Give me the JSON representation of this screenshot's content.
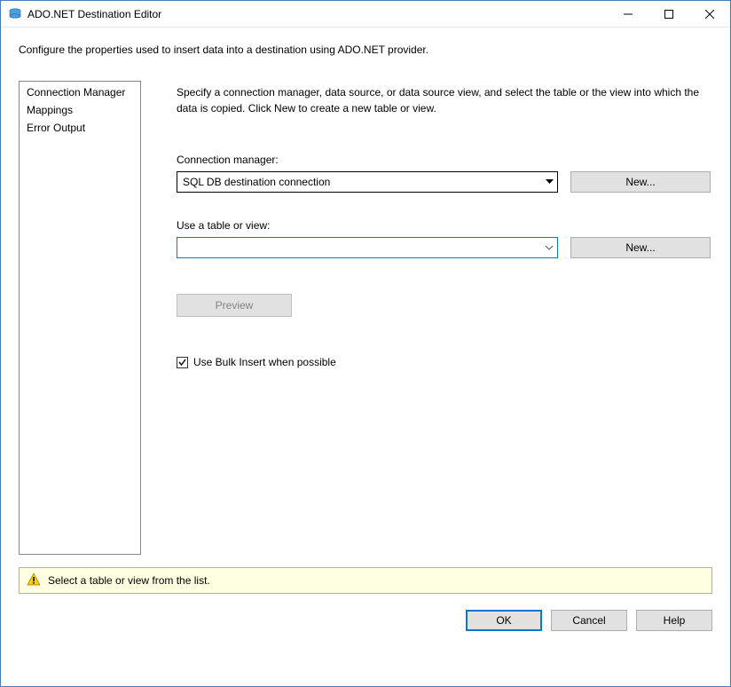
{
  "titlebar": {
    "title": "ADO.NET Destination Editor"
  },
  "description": "Configure the properties used to insert data into a destination using ADO.NET provider.",
  "nav": {
    "items": [
      {
        "label": "Connection Manager"
      },
      {
        "label": "Mappings"
      },
      {
        "label": "Error Output"
      }
    ]
  },
  "panel": {
    "desc": "Specify a connection manager, data source, or data source view, and select the table or the view into which the data is copied. Click New to create a new table or view.",
    "connection_manager_label": "Connection manager:",
    "connection_manager_value": "SQL DB destination connection",
    "new_button_1": "New...",
    "table_label": "Use a table or view:",
    "table_value": "",
    "new_button_2": "New...",
    "preview_button": "Preview",
    "bulk_insert_label": "Use Bulk Insert when possible",
    "bulk_insert_checked": true
  },
  "status": {
    "message": "Select a table or view from the list."
  },
  "buttons": {
    "ok": "OK",
    "cancel": "Cancel",
    "help": "Help"
  }
}
